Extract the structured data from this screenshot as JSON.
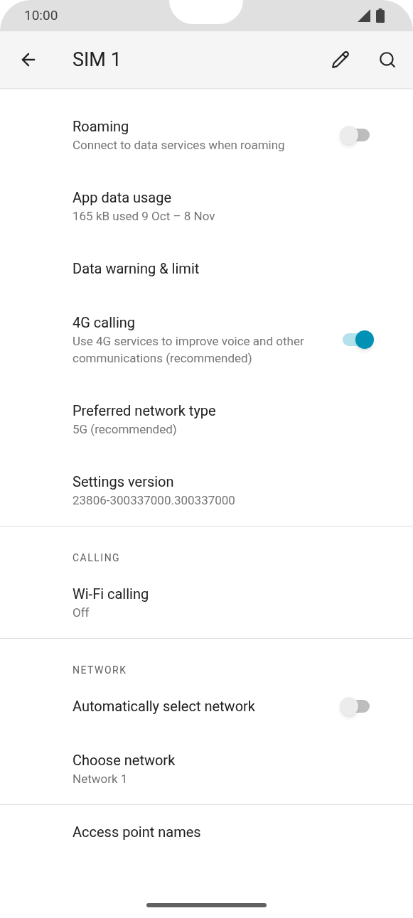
{
  "status_bar": {
    "time": "10:00"
  },
  "app_bar": {
    "title": "SIM 1"
  },
  "sections": [
    {
      "items": [
        {
          "kind": "switch",
          "title": "Roaming",
          "summary": "Connect to data services when roaming",
          "on": false
        },
        {
          "kind": "text",
          "title": "App data usage",
          "summary": "165 kB used 9 Oct – 8 Nov"
        },
        {
          "kind": "text",
          "title": "Data warning & limit"
        },
        {
          "kind": "switch",
          "title": "4G calling",
          "summary": "Use 4G services to improve voice and other communications (recommended)",
          "on": true
        },
        {
          "kind": "text",
          "title": "Preferred network type",
          "summary": "5G (recommended)"
        },
        {
          "kind": "text",
          "title": "Settings version",
          "summary": "23806-300337000.300337000"
        }
      ]
    },
    {
      "header": "CALLING",
      "items": [
        {
          "kind": "text",
          "title": "Wi-Fi calling",
          "summary": "Off"
        }
      ]
    },
    {
      "header": "NETWORK",
      "items": [
        {
          "kind": "switch",
          "title": "Automatically select network",
          "on": false
        },
        {
          "kind": "text",
          "title": "Choose network",
          "summary": "Network 1"
        }
      ]
    },
    {
      "items": [
        {
          "kind": "text",
          "title": "Access point names"
        }
      ]
    }
  ]
}
